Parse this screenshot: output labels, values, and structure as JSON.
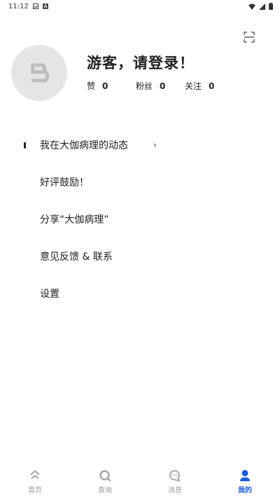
{
  "status_bar": {
    "time": "11:12",
    "left_icons": [
      "image-icon",
      "notification-a-icon"
    ],
    "right_icons": [
      "wifi-icon",
      "signal-icon",
      "battery-icon"
    ]
  },
  "header": {
    "scan_icon": "scan-icon"
  },
  "profile": {
    "avatar_icon": "login-arrow-icon",
    "greeting": "游客，请登录！",
    "stats": [
      {
        "label": "赞",
        "value": "0"
      },
      {
        "label": "粉丝",
        "value": "0"
      },
      {
        "label": "关注",
        "value": "0"
      }
    ]
  },
  "menu": {
    "items": [
      {
        "label": "我在大伽病理的动态",
        "has_chevron": true,
        "chevron": "›"
      },
      {
        "label": "好评鼓励！"
      },
      {
        "label": "分享“大伽病理”"
      },
      {
        "label": "意见反馈 & 联系"
      },
      {
        "label": "设置"
      }
    ]
  },
  "tabbar": {
    "tabs": [
      {
        "label": "首页",
        "icon": "home-icon",
        "active": false
      },
      {
        "label": "查询",
        "icon": "search-icon",
        "active": false
      },
      {
        "label": "消息",
        "icon": "message-icon",
        "active": false
      },
      {
        "label": "我的",
        "icon": "person-icon",
        "active": true
      }
    ],
    "active_color": "#1e5bd7",
    "inactive_color": "#9a9a9a"
  }
}
